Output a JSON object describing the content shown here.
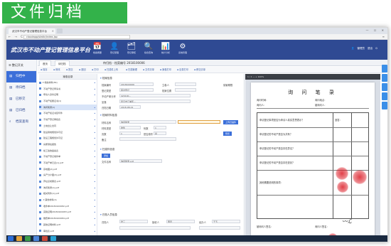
{
  "caption": "文件归档",
  "browser": {
    "tab_label": "武汉市不动产登记管理信息平台",
    "url": "cloudapp/static/index.jsp",
    "nav": "← → C",
    "winbtns": "— ☐ ✕"
  },
  "app": {
    "title": "武汉市不动产登记管理信息平台",
    "modules": [
      {
        "icon": "calendar-icon",
        "glyph": "📅",
        "label": "档案概要"
      },
      {
        "icon": "user-icon",
        "glyph": "👤",
        "label": "登记受理"
      },
      {
        "icon": "folder-icon",
        "glyph": "🗂",
        "label": "登记审核"
      },
      {
        "icon": "search-icon",
        "glyph": "🔍",
        "label": "综合查询"
      },
      {
        "icon": "chart-icon",
        "glyph": "📊",
        "label": "统计分析"
      },
      {
        "icon": "gear-icon",
        "glyph": "⚙",
        "label": "系统管理"
      }
    ],
    "user": "管理员",
    "exit": "退出"
  },
  "sidebar": {
    "head": "整记开关",
    "items": [
      {
        "label": "归档中",
        "active": true
      },
      {
        "label": "待归档",
        "active": false
      },
      {
        "label": "已移交",
        "active": false
      },
      {
        "label": "已归档",
        "active": false
      },
      {
        "label": "档案查询",
        "active": false
      }
    ]
  },
  "content_tabs": {
    "tab1": "首页",
    "tab2": "待归档",
    "current": "待归档 - 档案编号 2018100006"
  },
  "toolbar": [
    "保存",
    "修改",
    "提交",
    "退回",
    "打印",
    "扫描件上传",
    "扫描管理",
    "文件清单",
    "案卷打印",
    "目录打印",
    "移交清单"
  ],
  "tree": {
    "head": "案卷目录",
    "rows": [
      "▾ 档案材料(56)",
      "  不动产登记申请书",
      "  申请人身份证明",
      "  不动产权属证书(1)",
      "  询问笔录(1)",
      "  不动产权证书复印件",
      "  不动产登记审批表",
      "  土地出让合同",
      "  建设用地规划许可证",
      "  建设工程规划许可证",
      "  房屋测绘报告",
      "  竣工验收备案表",
      "  不动产登记收件单",
      "  不动产单元表(1).pdf",
      "  宗地图(2).pdf",
      "  房产分户图(3).pdf",
      "  界址点成果表.pdf",
      "  询问笔录(1).pdf",
      "  相关附件(1).pdf",
      "  ▾ 其他材料(4)",
      "  收件单20180100082.pdf",
      "  完税证明20180100083.pdf",
      "  缴费单20180100084.pdf",
      "  其他证明材料.pdf",
      "  审批表.pdf",
      "  档案封面.pdf"
    ]
  },
  "form": {
    "section_basic": "档案信息",
    "basic": [
      {
        "label": "档案编号",
        "value": "2018100006"
      },
      {
        "label": "登记类型",
        "value": "首次登记"
      },
      {
        "label": "不动产单元号",
        "value": "420100..."
      },
      {
        "label": "坐落",
        "value": "武汉市江岸区..."
      },
      {
        "label": "归档日期",
        "value": "2018-08-01"
      }
    ],
    "right_labels": [
      "立卷人",
      "档案位置",
      "保管期限"
    ],
    "section_doc": "档案材料信息",
    "doc_labels": [
      "材料名称",
      "材料类型",
      "份数",
      "页数",
      "是否原件",
      "备注"
    ],
    "doc_values": [
      "询问笔录",
      "收件",
      "1",
      "1",
      "是",
      ""
    ],
    "btn_upload": "上传扫描件",
    "btn_preview": "预览",
    "section_scan": "扫描件信息",
    "scan_label": "文件名称",
    "scan_value": "询问笔录.pdf",
    "section_person": "归档人员信息",
    "person_labels": [
      "归档人",
      "接收人",
      "经办人"
    ],
    "person_values": [
      "张三",
      "李四",
      "王五"
    ],
    "btn_add": "添加"
  },
  "preview": {
    "toolbar": "1 / 1   −  +   100%",
    "title": "询 问 笔 录",
    "line1": "询问时间：",
    "line2": "询问地点：",
    "line3": "询问人：",
    "line4": "被询问人：",
    "q1": "申请登记事项是否为申请人真实意思表示？",
    "q2": "申请登记的不动产是否为共有？",
    "q3": "申请登记的不动产是否存在异议？",
    "q4": "申请登记的不动产是否存在查封？",
    "q5": "其他需要说明的事项：",
    "answer_label": "回答：",
    "footer": "被询问人签名：",
    "footer2": "询问人签名："
  }
}
